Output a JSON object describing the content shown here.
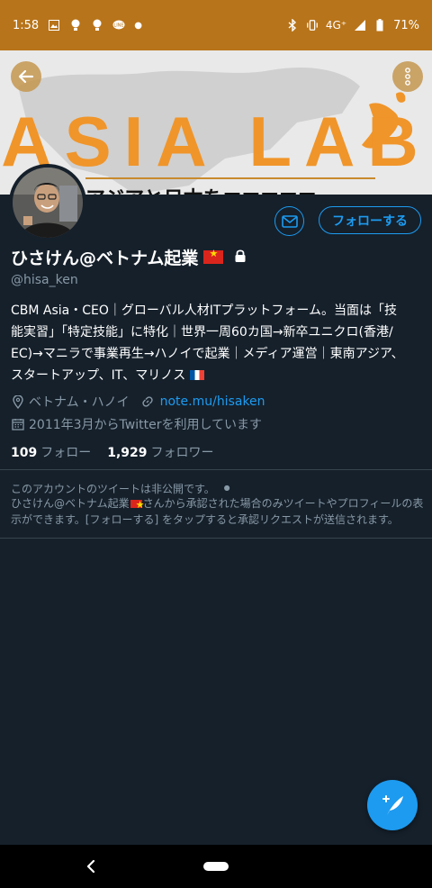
{
  "status_bar": {
    "time": "1:58",
    "network": "4G⁺",
    "battery": "71%"
  },
  "banner": {
    "title": "ASIA LAB",
    "subtitle": "アジアと日本を■■■■■"
  },
  "profile": {
    "display_name": "ひさけん@ベトナム起業",
    "handle": "@hisa_ken",
    "bio_lines": [
      "CBM Asia・CEO｜グローバル人材ITプラットフォーム。当面は「技",
      "能実習」「特定技能」に特化｜世界一周60カ国→新卒ユニクロ(香港/",
      "EC)→マニラで事業再生→ハノイで起業｜メディア運営｜東南アジア、",
      "スタートアップ、IT、マリノス"
    ],
    "location": "ベトナム・ハノイ",
    "website": "note.mu/hisaken",
    "joined": "2011年3月からTwitterを利用しています",
    "following_count": "109",
    "following_label": "フォロー",
    "followers_count": "1,929",
    "followers_label": "フォロワー"
  },
  "actions": {
    "follow_label": "フォローする"
  },
  "private_notice": {
    "title": "このアカウントのツイートは非公開です。",
    "body_name": "ひさけん@ベトナム起業",
    "body_text": "さんから承認された場合のみツイートやプロフィールの表示ができます。[フォローする] をタップすると承認リクエストが送信されます。"
  },
  "colors": {
    "status_bar": "#b8741a",
    "background": "#15202b",
    "accent": "#1d9bf0",
    "secondary_text": "#8899a6",
    "banner_title": "#f0952a"
  },
  "icons": [
    "back-arrow-icon",
    "more-vertical-icon",
    "mail-icon",
    "lock-icon",
    "location-pin-icon",
    "link-icon",
    "calendar-icon",
    "compose-tweet-icon"
  ]
}
